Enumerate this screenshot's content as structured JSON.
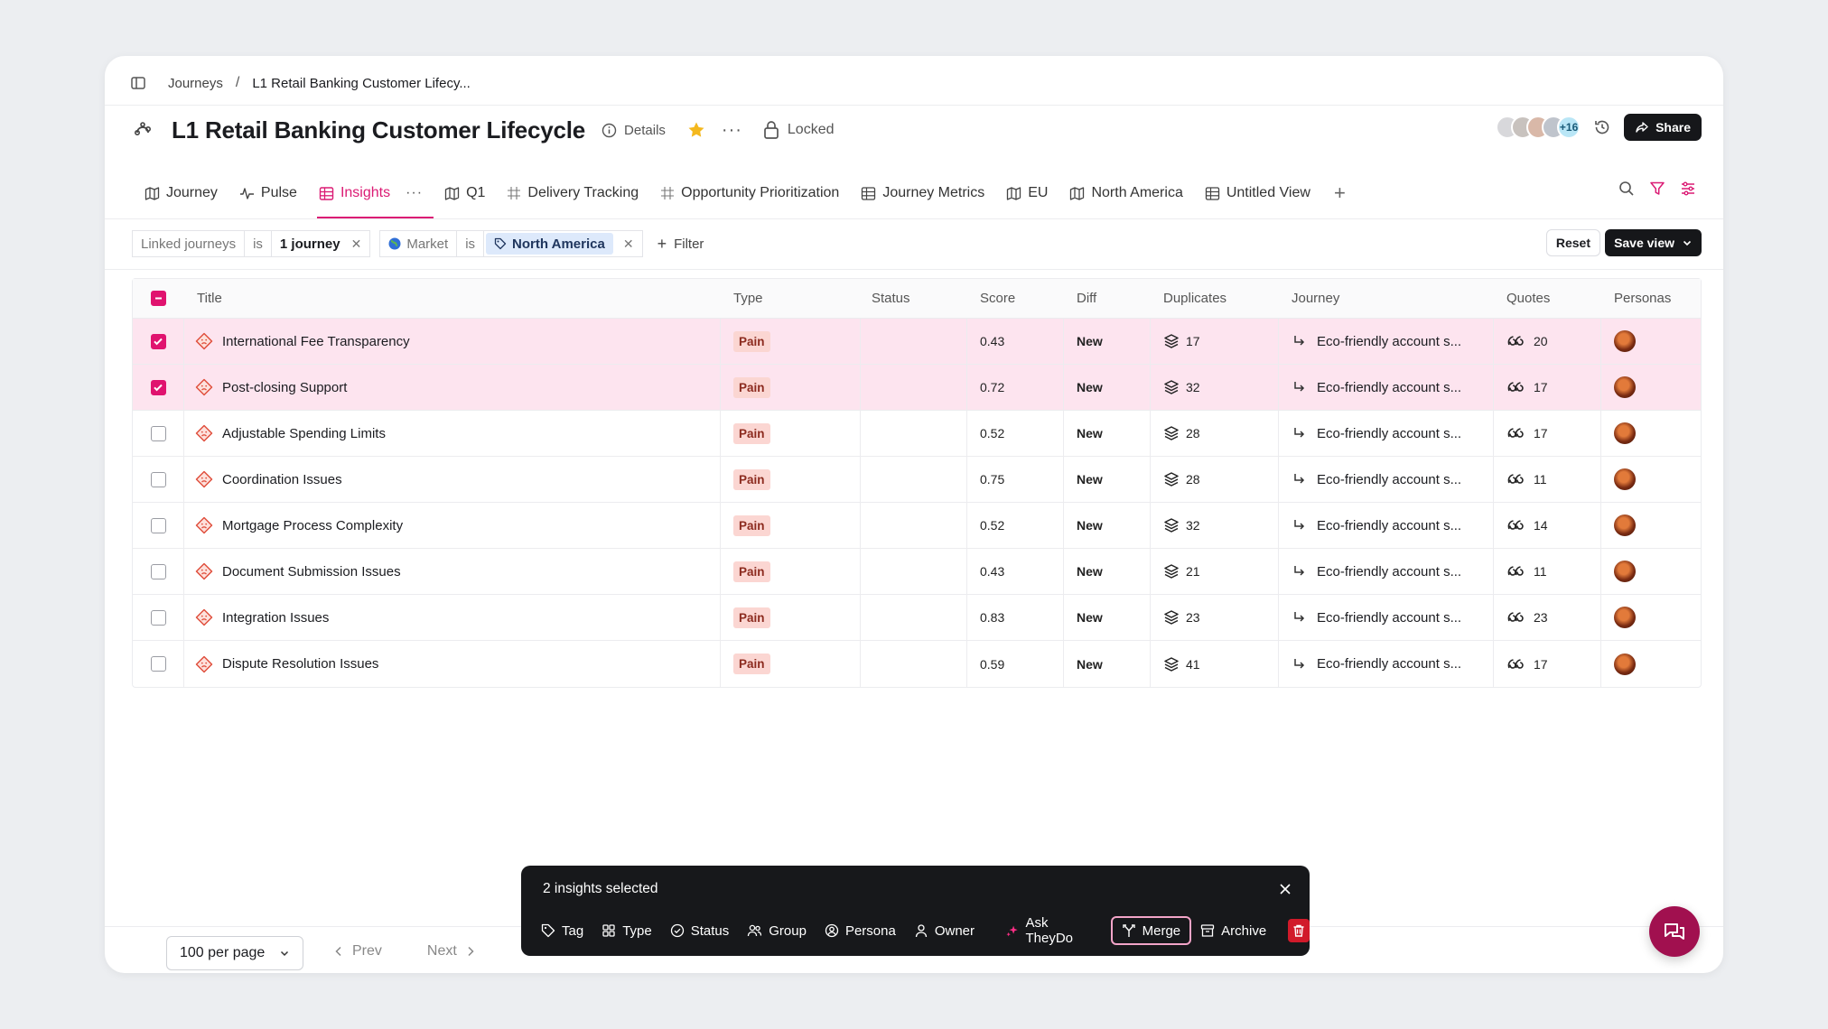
{
  "breadcrumb": {
    "root": "Journeys",
    "separator": "/",
    "current": "L1 Retail Banking Customer Lifecy..."
  },
  "header": {
    "title": "L1 Retail Banking Customer Lifecycle",
    "details_label": "Details",
    "locked_label": "Locked",
    "avatars_more": "+16",
    "share_label": "Share"
  },
  "tabs": [
    {
      "label": "Journey",
      "icon": "map-icon"
    },
    {
      "label": "Pulse",
      "icon": "pulse-icon"
    },
    {
      "label": "Insights",
      "icon": "table-icon",
      "active": true
    },
    {
      "label": "Q1",
      "icon": "map-icon"
    },
    {
      "label": "Delivery Tracking",
      "icon": "grid-icon"
    },
    {
      "label": "Opportunity Prioritization",
      "icon": "grid-icon"
    },
    {
      "label": "Journey Metrics",
      "icon": "table-icon"
    },
    {
      "label": "EU",
      "icon": "map-icon"
    },
    {
      "label": "North America",
      "icon": "map-icon"
    },
    {
      "label": "Untitled View",
      "icon": "table-icon"
    }
  ],
  "filters": {
    "f1": {
      "field": "Linked journeys",
      "op": "is",
      "value": "1 journey"
    },
    "f2": {
      "field": "Market",
      "op": "is",
      "value": "North America"
    },
    "add_label": "Filter",
    "reset_label": "Reset",
    "save_label": "Save view"
  },
  "table": {
    "columns": {
      "title": "Title",
      "type": "Type",
      "status": "Status",
      "score": "Score",
      "diff": "Diff",
      "duplicates": "Duplicates",
      "journey": "Journey",
      "quotes": "Quotes",
      "personas": "Personas"
    },
    "rows": [
      {
        "selected": true,
        "title": "International Fee Transparency",
        "type": "Pain",
        "status": "",
        "score": "0.43",
        "diff": "New",
        "duplicates": "17",
        "journey": "Eco-friendly account s...",
        "quotes": "20"
      },
      {
        "selected": true,
        "title": "Post-closing Support",
        "type": "Pain",
        "status": "",
        "score": "0.72",
        "diff": "New",
        "duplicates": "32",
        "journey": "Eco-friendly account s...",
        "quotes": "17"
      },
      {
        "selected": false,
        "title": "Adjustable Spending Limits",
        "type": "Pain",
        "status": "",
        "score": "0.52",
        "diff": "New",
        "duplicates": "28",
        "journey": "Eco-friendly account s...",
        "quotes": "17"
      },
      {
        "selected": false,
        "title": "Coordination Issues",
        "type": "Pain",
        "status": "",
        "score": "0.75",
        "diff": "New",
        "duplicates": "28",
        "journey": "Eco-friendly account s...",
        "quotes": "11"
      },
      {
        "selected": false,
        "title": "Mortgage Process Complexity",
        "type": "Pain",
        "status": "",
        "score": "0.52",
        "diff": "New",
        "duplicates": "32",
        "journey": "Eco-friendly account s...",
        "quotes": "14"
      },
      {
        "selected": false,
        "title": "Document Submission Issues",
        "type": "Pain",
        "status": "",
        "score": "0.43",
        "diff": "New",
        "duplicates": "21",
        "journey": "Eco-friendly account s...",
        "quotes": "11"
      },
      {
        "selected": false,
        "title": "Integration Issues",
        "type": "Pain",
        "status": "",
        "score": "0.83",
        "diff": "New",
        "duplicates": "23",
        "journey": "Eco-friendly account s...",
        "quotes": "23"
      },
      {
        "selected": false,
        "title": "Dispute Resolution Issues",
        "type": "Pain",
        "status": "",
        "score": "0.59",
        "diff": "New",
        "duplicates": "41",
        "journey": "Eco-friendly account s...",
        "quotes": "17"
      }
    ]
  },
  "pagination": {
    "per_page": "100 per page",
    "prev": "Prev",
    "next": "Next"
  },
  "selection_bar": {
    "title": "2 insights selected",
    "actions": {
      "tag": "Tag",
      "type": "Type",
      "status": "Status",
      "group": "Group",
      "persona": "Persona",
      "owner": "Owner",
      "ask": "Ask TheyDo",
      "merge": "Merge",
      "archive": "Archive"
    }
  },
  "colors": {
    "accent": "#db1b74",
    "selected_row": "#fde4ef",
    "pain_badge": "#fbd6d2",
    "dark": "#16171a"
  }
}
